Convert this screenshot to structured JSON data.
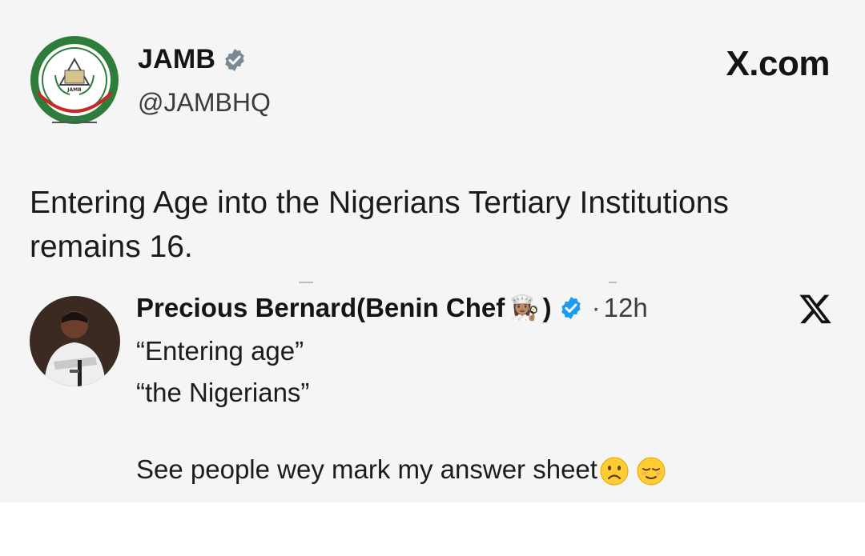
{
  "tweet": {
    "author_name": "JAMB",
    "handle": "@JAMBHQ",
    "source": "X.com",
    "text": "Entering Age into the Nigerians Tertiary Institutions remains 16."
  },
  "reply": {
    "author_name": "Precious Bernard(Benin Chef",
    "chef_emoji": "👩🏽‍🍳",
    "closing_paren": ")",
    "dot": "·",
    "time": "12h",
    "line1": "“Entering age”",
    "line2": "“the Nigerians”",
    "line3": "See people wey mark my answer sheet"
  },
  "colors": {
    "verified_grey": "#7a8a95",
    "verified_blue": "#1d9bf0",
    "jamb_green": "#2e7d3b"
  },
  "icons": [
    "verified-badge-icon",
    "x-logo-icon",
    "frowning-face-emoji-icon",
    "relieved-face-emoji-icon"
  ]
}
